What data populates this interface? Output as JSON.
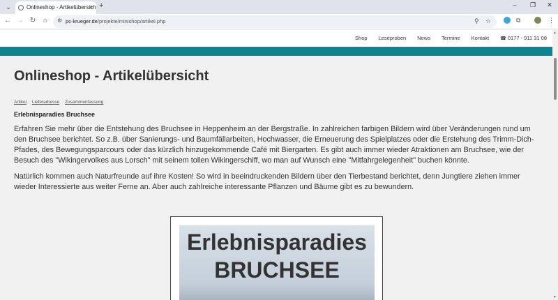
{
  "browser": {
    "tab_title": "Onlineshop - Artikelübersicht",
    "tab_close": "×",
    "new_tab": "+",
    "url_host": "pc-krueger.de",
    "url_path": "/projekte/minishop/artikel.php"
  },
  "nav": {
    "items": [
      "Shop",
      "Leseproben",
      "News",
      "Termine",
      "Kontakt"
    ],
    "phone": "0177 - 911 31 08"
  },
  "page": {
    "title": "Onlineshop - Artikelübersicht",
    "crumbs": [
      "Artikel",
      "Lieferadresse",
      "Zusammenfassung"
    ],
    "article_title": "Erlebnisparadies Bruchsee",
    "paragraph1": "Erfahren Sie mehr über die Entstehung des Bruchsee in Heppenheim an der Bergstraße. In zahlreichen farbigen Bildern wird über Veränderungen rund um den Bruchsee berichtet. So z.B. über Sanierungs- und Baumfällarbeiten, Hochwasser, die Erneuerung des Spielplatzes oder die Erstehung des Trimm-Dich-Pfades, des Bewegungsparcours oder das kürzlich hinzugekommende Café mit Biergarten. Es gibt auch immer wieder Atraktionen am Bruchsee, wie der Besuch des \"Wikingervolkes aus Lorsch\" mit seinem tollen Wikingerschiff, wo man auf Wunsch eine \"Mitfahrgelegenheit\" buchen könnte.",
    "paragraph2": "Natürlich kommen auch Naturfreunde auf ihre Kosten! So wird in beeindruckenden Bildern über den Tierbestand berichtet, denn Jungtiere ziehen immer wieder Interessierte aus weiter Ferne an. Aber auch zahlreiche interessante Pflanzen und Bäume gibt es zu bewundern.",
    "cover_line1": "Erlebnisparadies",
    "cover_line2": "BRUCHSEE"
  },
  "colors": {
    "accent_bar": "#0c8591"
  }
}
